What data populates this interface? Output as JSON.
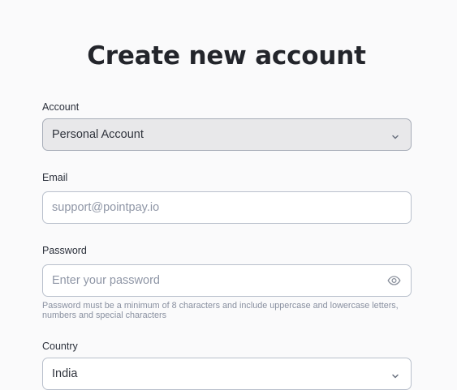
{
  "heading": "Create new account",
  "account": {
    "label": "Account",
    "value": "Personal Account"
  },
  "email": {
    "label": "Email",
    "placeholder": "support@pointpay.io"
  },
  "password": {
    "label": "Password",
    "placeholder": "Enter your password",
    "hint": "Password must be a minimum of 8 characters and include uppercase and lowercase letters, numbers and special characters"
  },
  "country": {
    "label": "Country",
    "value": "India"
  },
  "icons": {
    "dropdown": "chevron-down-icon",
    "password_toggle": "eye-icon"
  }
}
